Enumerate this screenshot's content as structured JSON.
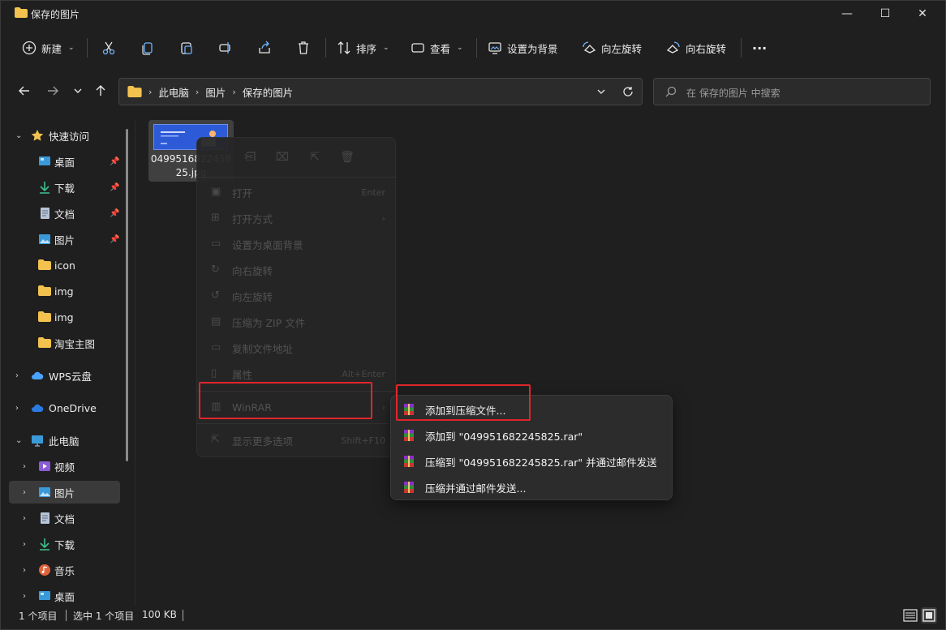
{
  "window": {
    "title": "保存的图片",
    "min_glyph": "—",
    "max_glyph": "☐",
    "close_glyph": "✕"
  },
  "toolbar": {
    "new_label": "新建",
    "sort_label": "排序",
    "view_label": "查看",
    "set_bg_label": "设置为背景",
    "rotate_left_label": "向左旋转",
    "rotate_right_label": "向右旋转",
    "more_label": "···"
  },
  "address": {
    "crumbs": [
      "此电脑",
      "图片",
      "保存的图片"
    ]
  },
  "search": {
    "placeholder": "在 保存的图片 中搜索"
  },
  "sidebar": {
    "quick_access": "快速访问",
    "items": [
      {
        "label": "桌面"
      },
      {
        "label": "下载"
      },
      {
        "label": "文档"
      },
      {
        "label": "图片"
      },
      {
        "label": "icon"
      },
      {
        "label": "img"
      },
      {
        "label": "img"
      },
      {
        "label": "淘宝主图"
      }
    ],
    "wps": "WPS云盘",
    "onedrive": "OneDrive",
    "this_pc": "此电脑",
    "pc_items": [
      {
        "label": "视频"
      },
      {
        "label": "图片"
      },
      {
        "label": "文档"
      },
      {
        "label": "下载"
      },
      {
        "label": "音乐"
      },
      {
        "label": "桌面"
      }
    ]
  },
  "file": {
    "name_line1": "0499516822458",
    "name_line2": "25.jpg"
  },
  "context_menu": {
    "items": [
      {
        "label": "打开",
        "shortcut": "Enter"
      },
      {
        "label": "打开方式",
        "shortcut": ""
      },
      {
        "label": "设置为桌面背景",
        "shortcut": ""
      },
      {
        "label": "向右旋转",
        "shortcut": ""
      },
      {
        "label": "向左旋转",
        "shortcut": ""
      },
      {
        "label": "压缩为 ZIP 文件",
        "shortcut": ""
      },
      {
        "label": "复制文件地址",
        "shortcut": ""
      },
      {
        "label": "属性",
        "shortcut": "Alt+Enter"
      }
    ],
    "winrar": "WinRAR",
    "more_options": "显示更多选项",
    "more_options_shortcut": "Shift+F10"
  },
  "submenu": {
    "items": [
      {
        "label": "添加到压缩文件..."
      },
      {
        "label": "添加到 \"049951682245825.rar\""
      },
      {
        "label": "压缩到 \"049951682245825.rar\" 并通过邮件发送"
      },
      {
        "label": "压缩并通过邮件发送..."
      }
    ]
  },
  "status": {
    "count": "1 个项目",
    "selected": "选中 1 个项目",
    "size": "100 KB"
  },
  "colors": {
    "accent_red": "#e0262b",
    "folder_yellow": "#f2c14e"
  }
}
